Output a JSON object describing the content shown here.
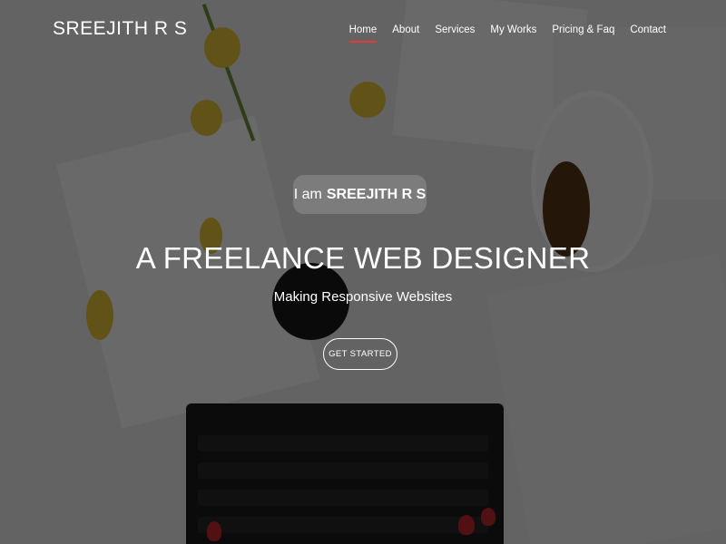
{
  "brand": "SREEJITH R S",
  "nav": [
    {
      "label": "Home",
      "active": true
    },
    {
      "label": "About",
      "active": false
    },
    {
      "label": "Services",
      "active": false
    },
    {
      "label": "My Works",
      "active": false
    },
    {
      "label": "Pricing & Faq",
      "active": false
    },
    {
      "label": "Contact",
      "active": false
    }
  ],
  "hero": {
    "intro_prefix": "I am",
    "intro_name": "SREEJITH R S",
    "headline": "A FREELANCE WEB DESIGNER",
    "subheadline": "Making Responsive Websites",
    "cta_label": "GET STARTED"
  },
  "colors": {
    "accent": "#e4383f",
    "text": "#ffffff"
  }
}
